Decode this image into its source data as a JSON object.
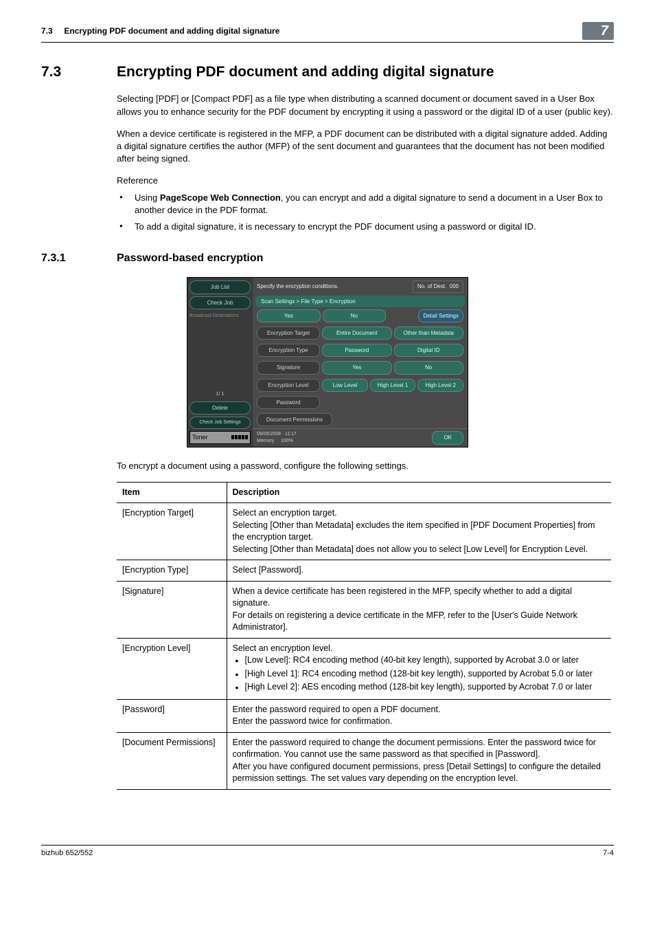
{
  "header": {
    "section_num": "7.3",
    "section_title": "Encrypting PDF document and adding digital signature",
    "chapter_badge": "7"
  },
  "section": {
    "num": "7.3",
    "title": "Encrypting PDF document and adding digital signature",
    "para1": "Selecting [PDF] or [Compact PDF] as a file type when distributing a scanned document or document saved in a User Box allows you to enhance security for the PDF document by encrypting it using a password or the digital ID of a user (public key).",
    "para2": "When a device certificate is registered in the MFP, a PDF document can be distributed with a digital signature added. Adding a digital signature certifies the author (MFP) of the sent document and guarantees that the document has not been modified after being signed.",
    "ref_label": "Reference",
    "ref1a": "Using ",
    "ref1b": "PageScope Web Connection",
    "ref1c": ", you can encrypt and add a digital signature to send a document in a User Box to another device in the PDF format.",
    "ref2": "To add a digital signature, it is necessary to encrypt the PDF document using a password or digital ID."
  },
  "subsection": {
    "num": "7.3.1",
    "title": "Password-based encryption"
  },
  "mfp": {
    "job_list": "Job List",
    "check_job": "Check Job",
    "broadcast": "Broadcast Destinations",
    "pager": "1/   1",
    "delete": "Delete",
    "check_job_settings": "Check Job Settings",
    "toner": "Toner",
    "instruction": "Specify the encryption conditions.",
    "dest_label": "No. of Dest.",
    "dest_count": "000",
    "crumb": "Scan Settings > File Type > Encryption",
    "yes": "Yes",
    "no": "No",
    "detail": "Detail Settings",
    "row_target": "Encryption Target",
    "entire": "Entire Document",
    "other_meta": "Other than Metadata",
    "row_type": "Encryption Type",
    "password": "Password",
    "digital_id": "Digital ID",
    "row_sig": "Signature",
    "row_level": "Encryption Level",
    "low": "Low Level",
    "high1": "High Level 1",
    "high2": "High Level 2",
    "row_pw": "Password",
    "row_perm": "Document Permissions",
    "date": "09/05/2008",
    "time": "11:17",
    "memory": "Memory",
    "mem_pct": "100%",
    "ok": "OK"
  },
  "intro_table": "To encrypt a document using a password, configure the following settings.",
  "table": {
    "h1": "Item",
    "h2": "Description",
    "r1c1": "[Encryption Target]",
    "r1c2": "Select an encryption target.\nSelecting [Other than Metadata] excludes the item specified in [PDF Document Properties] from the encryption target.\nSelecting [Other than Metadata] does not allow you to select [Low Level] for Encryption Level.",
    "r2c1": "[Encryption Type]",
    "r2c2": "Select [Password].",
    "r3c1": "[Signature]",
    "r3c2": "When a device certificate has been registered in the MFP, specify whether to add a digital signature.\nFor details on registering a device certificate in the MFP, refer to the [User's Guide Network Administrator].",
    "r4c1": "[Encryption Level]",
    "r4c2_intro": "Select an encryption level.",
    "r4_li1": "[Low Level]: RC4 encoding method (40-bit key length), supported by Acrobat 3.0 or later",
    "r4_li2": "[High Level 1]: RC4 encoding method (128-bit key length), supported by Acrobat 5.0 or later",
    "r4_li3": "[High Level 2]: AES encoding method (128-bit key length), supported by Acrobat 7.0 or later",
    "r5c1": "[Password]",
    "r5c2": "Enter the password required to open a PDF document.\nEnter the password twice for confirmation.",
    "r6c1": "[Document Permissions]",
    "r6c2": "Enter the password required to change the document permissions. Enter the password twice for confirmation. You cannot use the same password as that specified in [Password].\nAfter you have configured document permissions, press [Detail Settings] to configure the detailed permission settings. The set values vary depending on the encryption level."
  },
  "footer": {
    "left": "bizhub 652/552",
    "right": "7-4"
  }
}
